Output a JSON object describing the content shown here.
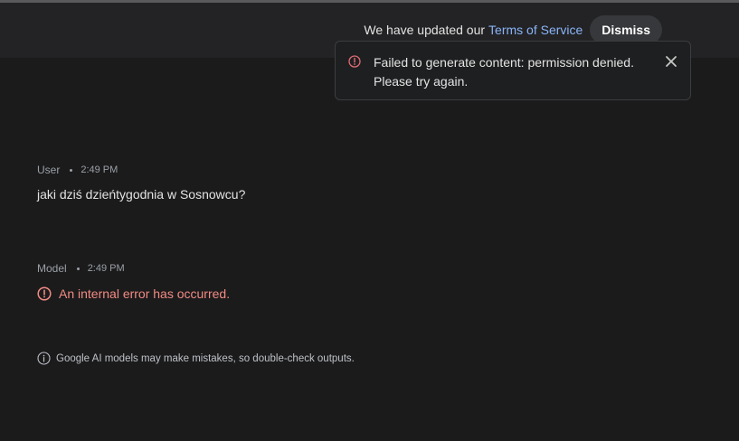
{
  "banner": {
    "text": "We have updated our",
    "link": "Terms of Service",
    "dismiss_label": "Dismiss"
  },
  "toast": {
    "message": "Failed to generate content: permission denied. Please try again.",
    "icon": "error-circle-icon",
    "close_icon": "close-icon"
  },
  "messages": [
    {
      "role": "User",
      "time": "2:49 PM",
      "text": "jaki dziś dzieńtygodnia w Sosnowcu?"
    },
    {
      "role": "Model",
      "time": "2:49 PM",
      "error": "An internal error has occurred."
    }
  ],
  "disclaimer": "Google AI models may make mistakes, so double-check outputs.",
  "colors": {
    "background": "#1b1b1c",
    "link": "#8ab4f8",
    "error": "#f28b82",
    "toast_icon": "#e06c75"
  }
}
